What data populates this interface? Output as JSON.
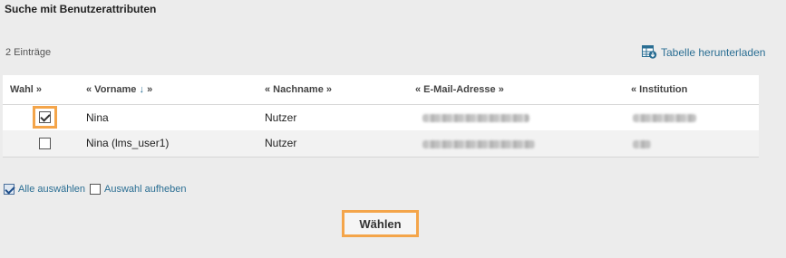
{
  "page": {
    "title": "Suche mit Benutzerattributen"
  },
  "toolbar": {
    "entry_count": "2 Einträge",
    "download_label": "Tabelle herunterladen",
    "download_icon": "table-download-icon"
  },
  "table": {
    "columns": [
      {
        "label": "Wahl »"
      },
      {
        "label": "« Vorname",
        "sort": "↓",
        "suffix": "»"
      },
      {
        "label": "« Nachname »"
      },
      {
        "label": "« E-Mail-Adresse »"
      },
      {
        "label": "« Institution"
      }
    ],
    "rows": [
      {
        "checked": true,
        "highlighted": true,
        "vorname": "Nina",
        "nachname": "Nutzer",
        "email_redacted": true,
        "institution_redacted": true
      },
      {
        "checked": false,
        "highlighted": false,
        "vorname": "Nina (lms_user1)",
        "nachname": "Nutzer",
        "email_redacted": true,
        "institution_redacted": true
      }
    ]
  },
  "selection": {
    "select_all_label": "Alle auswählen",
    "select_all_checked": true,
    "clear_label": "Auswahl aufheben",
    "clear_checked": false
  },
  "actions": {
    "choose_label": "Wählen"
  },
  "colors": {
    "highlight": "#f4a54a",
    "link": "#2a6e93"
  }
}
